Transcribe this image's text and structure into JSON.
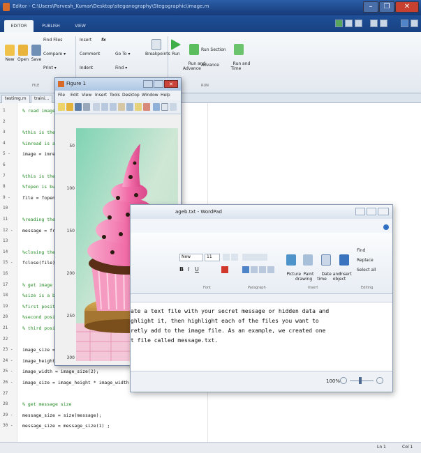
{
  "window": {
    "title": "Editor - C:\\Users\\Parvesh_Kumar\\Desktop\\steganography\\Stegographic\\image.m",
    "controls": [
      "–",
      "❐",
      "✕"
    ]
  },
  "tabs": [
    {
      "label": "EDITOR"
    },
    {
      "label": "PUBLISH"
    },
    {
      "label": "VIEW"
    }
  ],
  "ribbon": {
    "new_label": "New",
    "open_label": "Open",
    "save_label": "Save",
    "find_files_label": "Find Files",
    "compare_label": "Compare ▾",
    "print_label": "Print ▾",
    "insert_label": "Insert",
    "comment_label": "Comment",
    "indent_label": "Indent",
    "goto_label": "Go To ▾",
    "find_label": "Find ▾",
    "breakpoints_label": "Breakpoints",
    "run_label": "Run",
    "run_advance_label": "Run and\nAdvance",
    "run_section_label": "Run Section",
    "advance_label": "Advance",
    "run_time_label": "Run and\nTime",
    "section_file": "FILE",
    "section_run": "RUN",
    "fx_label": "fx"
  },
  "doc_tabs": [
    {
      "label": "testimg.m"
    },
    {
      "label": "traini..."
    }
  ],
  "code_lines": [
    {
      "n": "1",
      "text": "% read image",
      "kind": "cm"
    },
    {
      "n": "2",
      "text": "",
      "kind": "cd"
    },
    {
      "n": "3",
      "text": "%this is the",
      "kind": "cm"
    },
    {
      "n": "4",
      "text": "%imread is a",
      "kind": "cm"
    },
    {
      "n": "5 -",
      "text": "image = imre",
      "kind": "cd"
    },
    {
      "n": "6",
      "text": "",
      "kind": "cd"
    },
    {
      "n": "7",
      "text": "%this is the",
      "kind": "cm"
    },
    {
      "n": "8",
      "text": "%fopen is bu",
      "kind": "cm"
    },
    {
      "n": "9 -",
      "text": "file = fopen",
      "kind": "cd"
    },
    {
      "n": "10",
      "text": "",
      "kind": "cd"
    },
    {
      "n": "11",
      "text": "%reading the",
      "kind": "cm"
    },
    {
      "n": "12 -",
      "text": "message = fr",
      "kind": "cd"
    },
    {
      "n": "13",
      "text": "",
      "kind": "cd"
    },
    {
      "n": "14",
      "text": "%closing the",
      "kind": "cm"
    },
    {
      "n": "15 -",
      "text": "fclose(file)",
      "kind": "cd"
    },
    {
      "n": "16",
      "text": "",
      "kind": "cd"
    },
    {
      "n": "17",
      "text": "% get image",
      "kind": "cm"
    },
    {
      "n": "18",
      "text": "%size is a b",
      "kind": "cm"
    },
    {
      "n": "19",
      "text": "%first posit",
      "kind": "cm"
    },
    {
      "n": "20",
      "text": "%second posi",
      "kind": "cm"
    },
    {
      "n": "21",
      "text": "% third posi",
      "kind": "cm"
    },
    {
      "n": "22",
      "text": "",
      "kind": "cd"
    },
    {
      "n": "23 -",
      "text": "image_size =",
      "kind": "cd"
    },
    {
      "n": "24 -",
      "text": "image_height = image_size(1);",
      "kind": "cd"
    },
    {
      "n": "25 -",
      "text": "image_width = image_size(2);",
      "kind": "cd"
    },
    {
      "n": "26 -",
      "text": "image_size = image_height * image_width;",
      "kind": "cd"
    },
    {
      "n": "27",
      "text": "",
      "kind": "cd"
    },
    {
      "n": "28",
      "text": "% get message size",
      "kind": "cm"
    },
    {
      "n": "29 -",
      "text": "message_size = size(message);",
      "kind": "cd"
    },
    {
      "n": "30 -",
      "text": "message_size = message_size(1) ;",
      "kind": "cd"
    }
  ],
  "status": {
    "line": "Ln 1",
    "col": "Col 1"
  },
  "figure": {
    "title": "Figure 1",
    "menu": [
      "File",
      "Edit",
      "View",
      "Insert",
      "Tools",
      "Desktop",
      "Window",
      "Help"
    ],
    "yticks": [
      "50",
      "100",
      "150",
      "200",
      "250",
      "300"
    ]
  },
  "wordpad": {
    "title": "ageb.txt - WordPad",
    "font_name": "New",
    "font_size": "11",
    "groups": [
      "Font",
      "Paragraph",
      "Insert",
      "Editing"
    ],
    "insert_buttons": [
      "Picture",
      "Paint\ndrawing",
      "Date and\ntime",
      "Insert\nobject"
    ],
    "edit_buttons": [
      "Find",
      "Replace",
      "Select all"
    ],
    "text_lines": [
      "ate a text file with your secret message or hidden data and",
      "ghlight it, then highlight each of the files you want to",
      "retly add to the image file. As an example, we created one",
      "t file called message.txt."
    ],
    "zoom": "100%"
  },
  "colors": {
    "title_bar": "#1f4f96",
    "ribbon": "#eef2f6",
    "comment": "#228b22",
    "frosting": "#f06aa6",
    "cupcake_wrapper": "#f59ac0",
    "cake": "#5a2e17"
  }
}
